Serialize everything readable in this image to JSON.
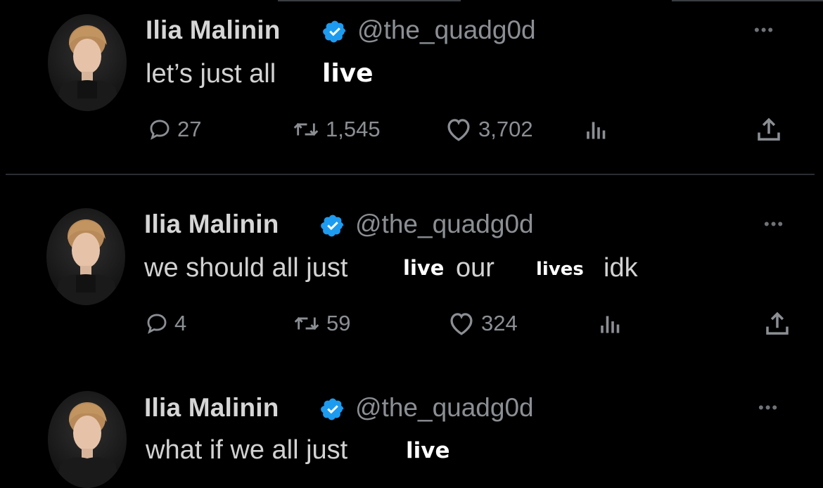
{
  "tweets": [
    {
      "name": "Ilia Malinin",
      "handle": "@the_quadg0d",
      "text": "let’s just all",
      "overlay": [
        "live"
      ],
      "replies": "27",
      "retweets": "1,545",
      "likes": "3,702"
    },
    {
      "name": "Ilia Malinin",
      "handle": "@the_quadg0d",
      "text_parts": [
        "we should all just",
        "our",
        "idk"
      ],
      "overlay": [
        "live",
        "lives"
      ],
      "replies": "4",
      "retweets": "59",
      "likes": "324"
    },
    {
      "name": "Ilia Malinin",
      "handle": "@the_quadg0d",
      "text": "what if we all just",
      "overlay": [
        "live"
      ]
    }
  ],
  "icons": {
    "verified": "verified-badge-icon",
    "more": "more-options-icon",
    "reply": "reply-icon",
    "retweet": "retweet-icon",
    "like": "like-icon",
    "views": "views-icon",
    "share": "share-icon"
  },
  "colors": {
    "background": "#000000",
    "verified": "#1d9bf0",
    "secondary_text": "#8b8f94"
  }
}
